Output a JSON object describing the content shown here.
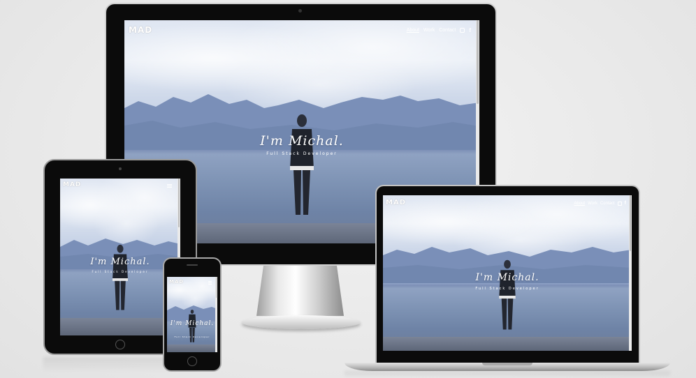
{
  "site": {
    "logo": "MAD",
    "nav": {
      "about": "About",
      "work": "Work",
      "contact": "Contact",
      "icons": [
        "instagram-icon",
        "facebook-icon"
      ]
    },
    "hero": {
      "title": "I'm Michal.",
      "subtitle": "Full Stack Developer"
    }
  },
  "colors": {
    "bezel": "#0b0b0b",
    "sky": "#dfe6f2",
    "mountains": "#7d90b6",
    "water": "#8fa2c2",
    "background": "#ececec"
  }
}
